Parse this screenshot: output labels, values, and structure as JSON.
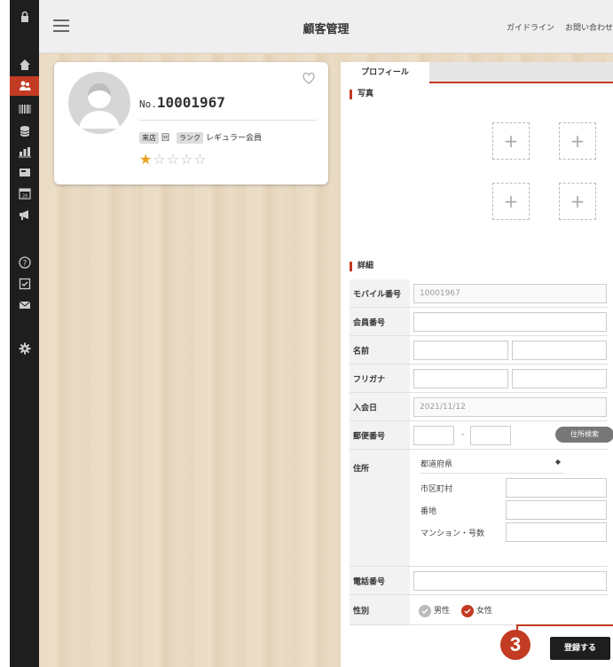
{
  "header": {
    "title": "顧客管理",
    "links": [
      "ガイドライン",
      "お問い合わせ"
    ]
  },
  "card": {
    "member_prefix": "No.",
    "member_number": "10001967",
    "visit_label": "来店",
    "visit_count": "回",
    "rank_label": "ランク",
    "rank_value": "レギュラー会員",
    "rating": "1 of 5 stars"
  },
  "panel": {
    "tab": "プロフィール",
    "photo_section": "写真",
    "detail_section": "詳細",
    "fields": {
      "mobile": {
        "label": "モバイル番号",
        "value": "10001967"
      },
      "member_no": {
        "label": "会員番号"
      },
      "name": {
        "label": "名前"
      },
      "furigana": {
        "label": "フリガナ"
      },
      "join_date": {
        "label": "入会日",
        "value": "2021/11/12"
      },
      "postal": {
        "label": "郵便番号",
        "separator": "-",
        "search_button": "住所検索"
      },
      "address": {
        "label": "住所",
        "prefecture": "都道府県",
        "city_label": "市区町村",
        "street_label": "番地",
        "building_label": "マンション・号数"
      },
      "phone": {
        "label": "電話番号"
      },
      "gender": {
        "label": "性別",
        "male": "男性",
        "female": "女性",
        "selected": "女性"
      }
    },
    "register_button": "登録する",
    "step_number": "3"
  },
  "colors": {
    "accent": "#c23b22",
    "sidebar": "#1e1e1e",
    "star": "#e8a11a"
  }
}
